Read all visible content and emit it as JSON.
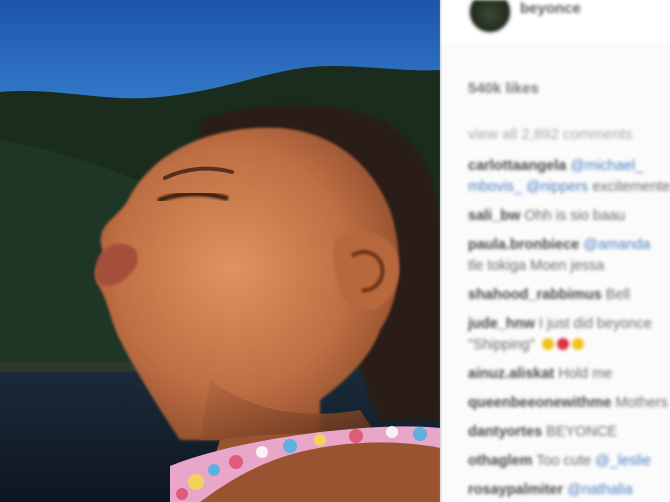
{
  "post": {
    "image_alt": "Close-up profile photo of a child with eyes closed against a mountain and lake backdrop",
    "colors": {
      "sky": "#2f73c8",
      "mountain": "#1a2f1e",
      "skin": "#c87a50",
      "mention": "#4b7fc0"
    }
  },
  "header": {
    "username": "beyonce"
  },
  "likes_text": "540k likes",
  "view_all_text": "view all 2,892 comments",
  "comments": [
    {
      "user": "carlottaangela",
      "mention1": "@michael_",
      "line2_mention": "mbovis_ @nippers",
      "line2_text": "excitemente"
    },
    {
      "user": "sali_bw",
      "text": "Ohh is sio baau"
    },
    {
      "user": "paula.bronbiece",
      "mention1": "@amanda",
      "line2_text": "tle tokiga Moen jessa"
    },
    {
      "user": "shahood_rabbimus",
      "text": "Bell"
    },
    {
      "user": "jude_hnw",
      "text": "I just did beyonce",
      "line2_text": "\"Shipping\"",
      "emojis": [
        "#f0c419",
        "#d9333f",
        "#f0c419"
      ]
    },
    {
      "user": "ainuz.aliskat",
      "text": "Hold me"
    },
    {
      "user": "queenbeeonewithme",
      "text": "Mothers"
    },
    {
      "user": "dantyortes",
      "text": "BEYONCE"
    },
    {
      "user": "othaglem",
      "text": "Too cute",
      "mention1": "@_leslie"
    },
    {
      "user": "rosaypalmiter",
      "mention1": "@nathalia"
    }
  ]
}
